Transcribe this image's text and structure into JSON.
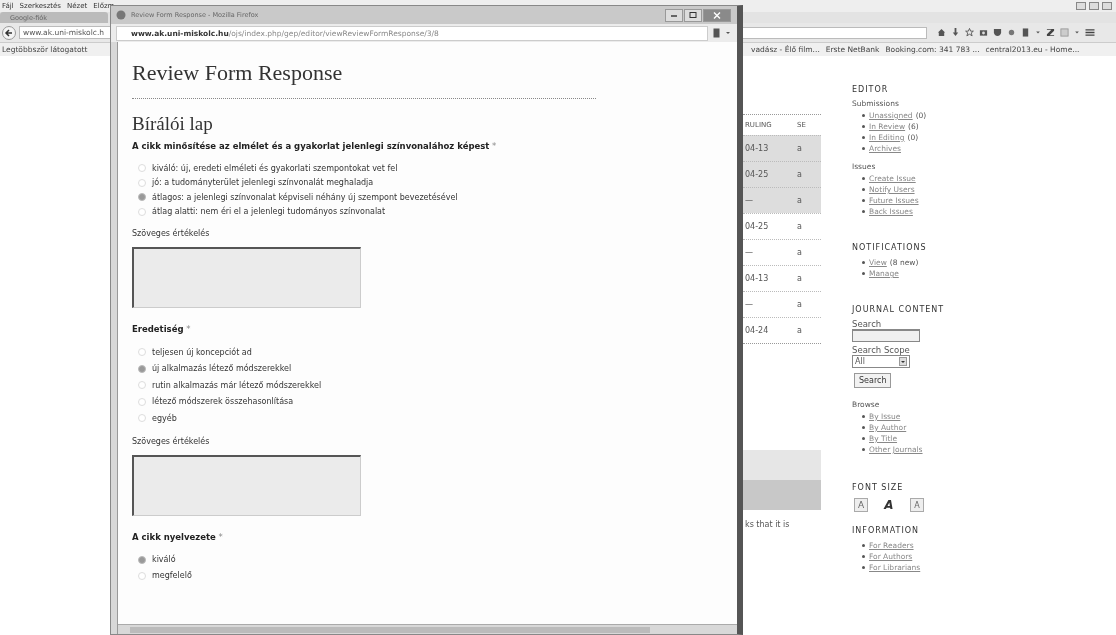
{
  "background_browser": {
    "menu": [
      "Fájl",
      "Szerkesztés",
      "Nézet",
      "Előzm"
    ],
    "tab": "Google-fiók",
    "address": "www.ak.uni-miskolc.h",
    "bookmarks_left": [
      "Legtöbbször látogatott"
    ],
    "bookmarks_right": [
      "vadász - Élő film...",
      "Erste NetBank",
      "Booking.com: 341 783 ...",
      "central2013.eu - Home..."
    ],
    "table": {
      "columns": [
        "RULING",
        "SE"
      ],
      "rows": [
        {
          "date": "04-13",
          "se": "a",
          "highlighted": true
        },
        {
          "date": "04-25",
          "se": "a",
          "highlighted": true
        },
        {
          "date": "—",
          "se": "a",
          "highlighted": true
        },
        {
          "date": "04-25",
          "se": "a",
          "highlighted": false
        },
        {
          "date": "—",
          "se": "a",
          "highlighted": false
        },
        {
          "date": "04-13",
          "se": "a",
          "highlighted": false
        },
        {
          "date": "—",
          "se": "a",
          "highlighted": false
        },
        {
          "date": "04-24",
          "se": "a",
          "highlighted": false
        }
      ]
    },
    "text_fragment": "ks that it is",
    "sidebar": {
      "editor": {
        "title": "EDITOR",
        "groups": [
          {
            "title": "Submissions",
            "items": [
              {
                "label": "Unassigned",
                "count": "(0)"
              },
              {
                "label": "In Review",
                "count": "(6)"
              },
              {
                "label": "In Editing",
                "count": "(0)"
              },
              {
                "label": "Archives"
              }
            ]
          },
          {
            "title": "Issues",
            "items": [
              {
                "label": "Create Issue"
              },
              {
                "label": "Notify Users"
              },
              {
                "label": "Future Issues"
              },
              {
                "label": "Back Issues"
              }
            ]
          }
        ]
      },
      "notifications": {
        "title": "NOTIFICATIONS",
        "items": [
          {
            "label": "View",
            "count": "(8 new)"
          },
          {
            "label": "Manage"
          }
        ]
      },
      "journal_content": {
        "title": "JOURNAL CONTENT",
        "search_label": "Search",
        "scope_label": "Search Scope",
        "scope_value": "All",
        "search_button": "Search",
        "browse_title": "Browse",
        "browse_items": [
          {
            "label": "By Issue"
          },
          {
            "label": "By Author"
          },
          {
            "label": "By Title"
          },
          {
            "label": "Other Journals"
          }
        ]
      },
      "font_size": {
        "title": "FONT SIZE",
        "buttons": [
          "A",
          "A",
          "A"
        ]
      },
      "information": {
        "title": "INFORMATION",
        "items": [
          {
            "label": "For Readers"
          },
          {
            "label": "For Authors"
          },
          {
            "label": "For Librarians"
          }
        ]
      }
    }
  },
  "popup": {
    "title": "Review Form Response - Mozilla Firefox",
    "url_host": "www.ak.uni-miskolc.hu",
    "url_path": "/ojs/index.php/gep/editor/viewReviewFormResponse/3/8",
    "heading": "Review Form Response",
    "form_title": "Bírálói lap",
    "sections": [
      {
        "question": "A cikk minősítése az elmélet és a gyakorlat jelenlegi színvonalához képest",
        "required": "*",
        "options": [
          {
            "label": "kiváló: új, eredeti elméleti és gyakorlati szempontokat vet fel",
            "selected": false
          },
          {
            "label": "jó: a tudományterület jelenlegi színvonalát meghaladja",
            "selected": false
          },
          {
            "label": "átlagos: a jelenlegi színvonalat képviseli néhány új szempont bevezetésével",
            "selected": true
          },
          {
            "label": "átlag alatti: nem éri el a jelenlegi tudományos színvonalat",
            "selected": false
          }
        ],
        "comment_label": "Szöveges értékelés"
      },
      {
        "question": "Eredetiség",
        "required": "*",
        "options": [
          {
            "label": "teljesen új koncepciót ad",
            "selected": false
          },
          {
            "label": "új alkalmazás létező módszerekkel",
            "selected": true
          },
          {
            "label": "rutin alkalmazás már létező módszerekkel",
            "selected": false
          },
          {
            "label": "létező módszerek összehasonlítása",
            "selected": false
          },
          {
            "label": "egyéb",
            "selected": false
          }
        ],
        "comment_label": "Szöveges értékelés"
      },
      {
        "question": "A cikk nyelvezete",
        "required": "*",
        "options": [
          {
            "label": "kiváló",
            "selected": true
          },
          {
            "label": "megfelelő",
            "selected": false
          }
        ]
      }
    ]
  }
}
